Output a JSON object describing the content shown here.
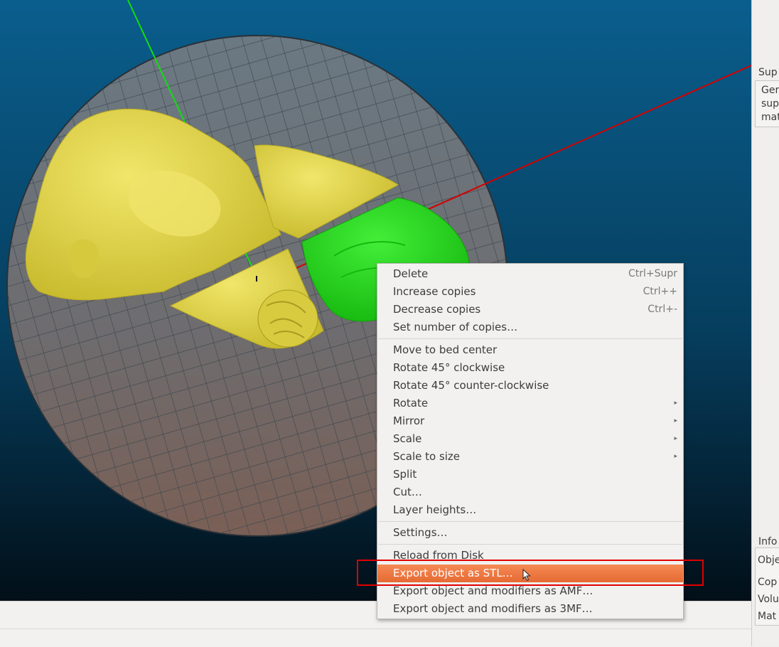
{
  "viewport": {
    "colors": {
      "bg_top": "#0a5e8d",
      "bg_bottom": "#021723",
      "bed": "#67737c",
      "bed_grid": "#3a454d",
      "model_yellow": "#e9dd55",
      "model_green": "#2fe126",
      "axis_x": "#d40000",
      "axis_y": "#11dd11"
    }
  },
  "context_menu": {
    "items": [
      {
        "label": "Delete",
        "shortcut": "Ctrl+Supr"
      },
      {
        "label": "Increase copies",
        "shortcut": "Ctrl++"
      },
      {
        "label": "Decrease copies",
        "shortcut": "Ctrl+-"
      },
      {
        "label": "Set number of copies…",
        "shortcut": ""
      },
      {
        "label": "Move to bed center",
        "shortcut": ""
      },
      {
        "label": "Rotate 45° clockwise",
        "shortcut": ""
      },
      {
        "label": "Rotate 45° counter-clockwise",
        "shortcut": ""
      },
      {
        "label": "Rotate",
        "shortcut": "",
        "submenu": true
      },
      {
        "label": "Mirror",
        "shortcut": "",
        "submenu": true
      },
      {
        "label": "Scale",
        "shortcut": "",
        "submenu": true
      },
      {
        "label": "Scale to size",
        "shortcut": "",
        "submenu": true
      },
      {
        "label": "Split",
        "shortcut": ""
      },
      {
        "label": "Cut…",
        "shortcut": ""
      },
      {
        "label": "Layer heights…",
        "shortcut": ""
      },
      {
        "label": "Settings…",
        "shortcut": ""
      },
      {
        "label": "Reload from Disk",
        "shortcut": ""
      },
      {
        "label": "Export object as STL…",
        "shortcut": "",
        "highlighted": true
      },
      {
        "label": "Export object and modifiers as AMF…",
        "shortcut": ""
      },
      {
        "label": "Export object and modifiers as 3MF…",
        "shortcut": ""
      }
    ],
    "highlight_color": "#ee7a44",
    "annotation_color": "#e00000"
  },
  "right_panel": {
    "support_heading": "Sup",
    "support_lines": [
      "Ger",
      "sup",
      "mat"
    ],
    "info_heading": "Info",
    "info_rows": [
      "Obje",
      "Cop",
      "Volu",
      "Mat"
    ]
  }
}
